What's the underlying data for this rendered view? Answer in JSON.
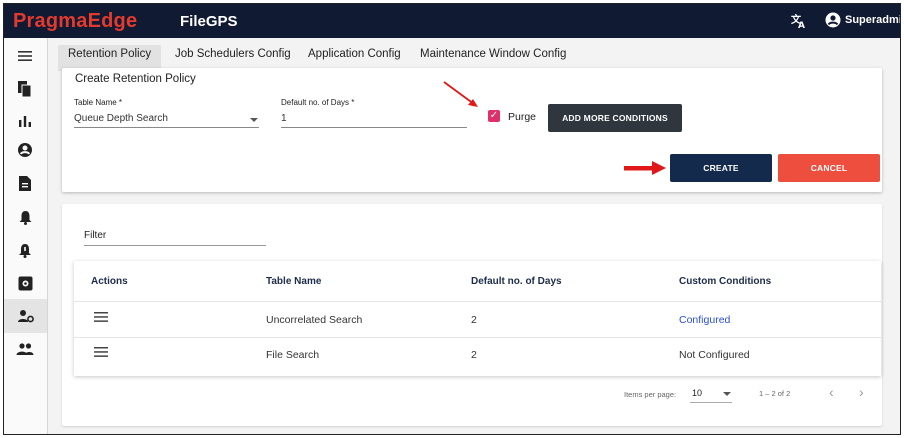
{
  "app": {
    "brand": "PragmaEdge",
    "product": "FileGPS",
    "user": "Superadmin",
    "brand_color": "#e23a2e",
    "header_color": "#101a33"
  },
  "icons": {
    "language": "translate-icon",
    "user": "account-circle-icon"
  },
  "sidebar": {
    "items": [
      {
        "icon": "menu-icon"
      },
      {
        "icon": "files-icon"
      },
      {
        "icon": "bar-chart-icon"
      },
      {
        "icon": "account-icon"
      },
      {
        "icon": "document-icon"
      },
      {
        "icon": "bell-icon"
      },
      {
        "icon": "bell-alert-icon"
      },
      {
        "icon": "settings-box-icon"
      },
      {
        "icon": "user-settings-icon",
        "active": true
      },
      {
        "icon": "group-icon"
      }
    ]
  },
  "tabs": [
    {
      "label": "Retention Policy",
      "active": true
    },
    {
      "label": "Job Schedulers Config"
    },
    {
      "label": "Application Config"
    },
    {
      "label": "Maintenance Window Config"
    }
  ],
  "create_form": {
    "title": "Create Retention Policy",
    "table_name_label": "Table Name *",
    "table_name_value": "Queue Depth Search",
    "days_label": "Default no. of Days *",
    "days_value": "1",
    "purge_label": "Purge",
    "purge_checked": true,
    "add_conditions_label": "ADD MORE CONDITIONS",
    "create_label": "CREATE",
    "cancel_label": "CANCEL"
  },
  "filter": {
    "label": "Filter"
  },
  "table": {
    "columns": [
      "Actions",
      "Table Name",
      "Default no. of Days",
      "Custom Conditions"
    ],
    "rows": [
      {
        "table_name": "Uncorrelated Search",
        "days": "2",
        "conditions": "Configured",
        "link": true
      },
      {
        "table_name": "File Search",
        "days": "2",
        "conditions": "Not Configured",
        "link": false
      }
    ]
  },
  "pagination": {
    "items_per_page_label": "Items per page:",
    "items_per_page": "10",
    "range": "1 – 2 of 2"
  }
}
